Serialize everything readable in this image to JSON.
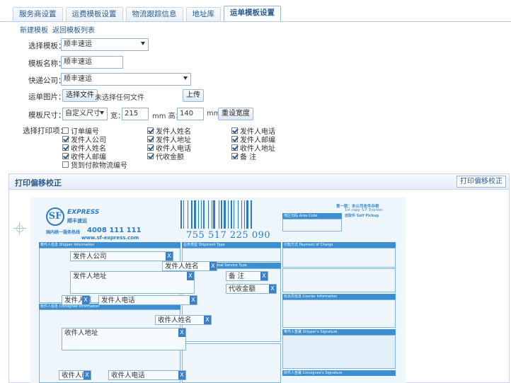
{
  "tabs": [
    {
      "label": "服务商设置",
      "active": false
    },
    {
      "label": "运费模板设置",
      "active": false
    },
    {
      "label": "物流跟踪信息",
      "active": false
    },
    {
      "label": "地址库",
      "active": false
    },
    {
      "label": "运单模板设置",
      "active": true
    }
  ],
  "subnav": {
    "new_template": "新建模板",
    "back_list": "返回模板列表"
  },
  "form": {
    "select_template_label": "选择模板：",
    "select_template_value": "顺丰速运",
    "template_name_label": "模板名称：",
    "template_name_value": "顺丰速运",
    "courier_label": "快递公司：",
    "courier_value": "顺丰速运",
    "image_label": "运单图片：",
    "choose_file": "选择文件",
    "no_file": "未选择任何文件",
    "upload": "上传",
    "size_label": "模板尺寸：",
    "size_value": "自定义尺寸",
    "width_label": "宽：",
    "width_value": "215",
    "height_label": "mm 高：",
    "height_value": "140",
    "unit": "mm",
    "reset_size": "重设宽度",
    "print_items_label": "选择打印项："
  },
  "print_items": [
    {
      "label": "订单编号",
      "checked": false
    },
    {
      "label": "发件人姓名",
      "checked": true
    },
    {
      "label": "发件人电话",
      "checked": true
    },
    {
      "label": "发件人公司",
      "checked": true
    },
    {
      "label": "发件人地址",
      "checked": true
    },
    {
      "label": "发件人邮编",
      "checked": true
    },
    {
      "label": "收件人姓名",
      "checked": true
    },
    {
      "label": "收件人电话",
      "checked": true
    },
    {
      "label": "收件人地址",
      "checked": true
    },
    {
      "label": "收件人邮编",
      "checked": true
    },
    {
      "label": "代收金额",
      "checked": true
    },
    {
      "label": "备 注",
      "checked": true
    },
    {
      "label": "货到付款物流编号",
      "checked": false
    }
  ],
  "panel": {
    "title": "打印偏移校正",
    "button": "打印偏移校正"
  },
  "waybill": {
    "brand": "EXPRESS",
    "brand_cn": "顺丰速运",
    "hotline_cn": "国内统一服务热线",
    "hotline": "4008 111 111",
    "website": "www.sf-express.com",
    "barcode_number": "755 517 225 090",
    "copy_label": "第一联：本公司收件存根",
    "copy_en": "1st copy: S.F. Express",
    "area_code": "地区代码 Area Code",
    "self_pickup": "自取件 Self Pickup",
    "shipper_info": "寄件人信息 Shipper Information",
    "shipment_type": "业务类型 Shipment Type",
    "payment": "付款方式 Payment of Charge",
    "additional": "增值业务类型 Additional Service Type",
    "consignee_info": "收件人信息 Consignee Information",
    "courier_info": "收派员信息 Courier Information",
    "shipper_sig": "寄件人签署 Shipper's Signature",
    "consignee_sig": "收件人签署 Consignee's Signature",
    "sender_company_field": "发件人公司",
    "sender_name_field": "发件人姓名",
    "sender_address_field": "发件人地址",
    "sender_zip_field": "发件人邮",
    "sender_phone_field": "发件人电话",
    "cod_field": "代收金额",
    "remark_field": "备 注",
    "recv_name_field": "收件人姓名",
    "recv_address_field": "收件人地址",
    "recv_zip_field": "收件人邮",
    "recv_phone_field": "收件人电话",
    "close_glyph": "X"
  }
}
